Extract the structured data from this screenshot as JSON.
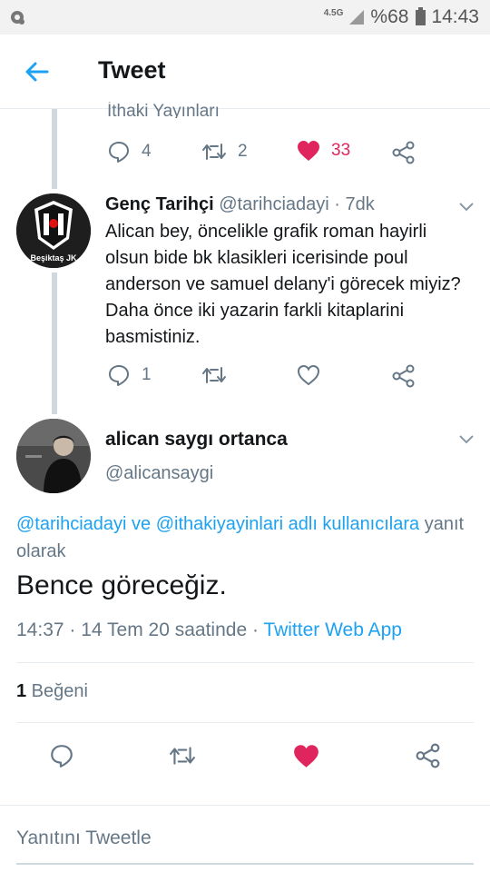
{
  "status_bar": {
    "network": "4.5G",
    "battery": "%68",
    "time": "14:43"
  },
  "header": {
    "title": "Tweet"
  },
  "prev_tweet": {
    "partial_text": "İthaki Yayınları",
    "reply_count": "4",
    "retweet_count": "2",
    "like_count": "33"
  },
  "reply_tweet": {
    "avatar_caption": "Beşiktaş JK",
    "name": "Genç Tarihçi",
    "handle": "@tarihciadayi",
    "separator": " · ",
    "time": "7dk",
    "text": "Alican bey, öncelikle grafik roman hayirli olsun bide bk klasikleri icerisinde poul anderson ve samuel delany'i görecek miyiz? Daha önce iki yazarin farkli kitaplarini basmistiniz.",
    "reply_count": "1"
  },
  "main_tweet": {
    "name": "alican saygı ortanca",
    "handle": "@alicansaygi",
    "reply_to_mention1": "@tarihciadayi",
    "reply_to_and": " ve ",
    "reply_to_mention2": "@ithakiyayinlari adlı kullanıcılara",
    "reply_to_suffix": " yanıt olarak",
    "text": "Bence göreceğiz.",
    "timestamp": "14:37 · 14 Tem 20 saatinde · ",
    "source": "Twitter Web App",
    "like_count": "1",
    "like_label": " Beğeni"
  },
  "reply_input": {
    "placeholder": "Yanıtını Tweetle"
  },
  "colors": {
    "accent": "#1da1f2",
    "like": "#e0245e",
    "muted": "#657786"
  }
}
